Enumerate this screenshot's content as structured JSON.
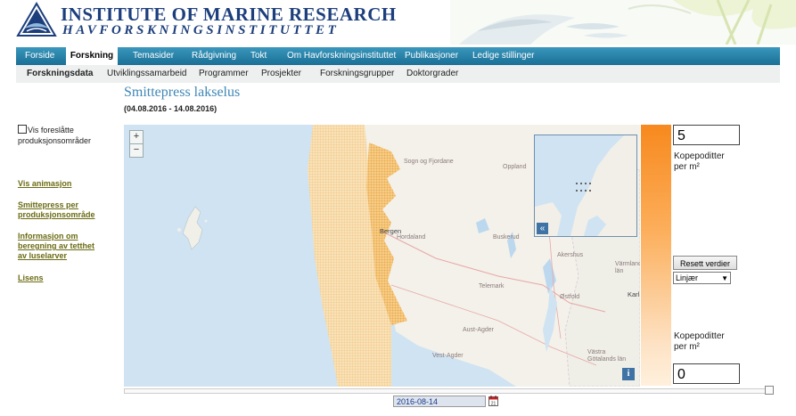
{
  "header": {
    "institute_name": "INSTITUTE OF MARINE RESEARCH",
    "institute_name_no": "HAVFORSKNINGSINSTITUTTET"
  },
  "nav_main": {
    "items": [
      {
        "label": "Forside"
      },
      {
        "label": "Forskning",
        "active": true
      },
      {
        "label": "Temasider"
      },
      {
        "label": "Rådgivning"
      },
      {
        "label": "Tokt"
      },
      {
        "label": "Om Havforskningsinstituttet"
      },
      {
        "label": "Publikasjoner"
      },
      {
        "label": "Ledige stillinger"
      }
    ]
  },
  "nav_sub": {
    "items": [
      {
        "label": "Forskningsdata",
        "active": true
      },
      {
        "label": "Utviklingssamarbeid"
      },
      {
        "label": "Programmer"
      },
      {
        "label": "Prosjekter"
      },
      {
        "label": "Forskningsgrupper"
      },
      {
        "label": "Doktorgrader"
      }
    ]
  },
  "page": {
    "title": "Smittepress lakselus",
    "date_range": "(04.08.2016 - 14.08.2016)"
  },
  "sidebar": {
    "checkbox_label": "Vis foreslåtte produksjonsområder",
    "checkbox_checked": false,
    "links": [
      {
        "label": "Vis animasjon"
      },
      {
        "label": "Smittepress per produksjonsområde"
      },
      {
        "label": "Informasjon om beregning av tetthet av luselarver"
      },
      {
        "label": "Lisens"
      }
    ]
  },
  "map": {
    "zoom_in": "+",
    "zoom_out": "−",
    "inset_toggle": "«",
    "info": "i",
    "labels": {
      "sogn": "Sogn og Fjordane",
      "oppland": "Oppland",
      "bergen": "Bergen",
      "hordaland": "Hordaland",
      "buskerud": "Buskerud",
      "akershus": "Akershus",
      "varmland": "Värmland län",
      "telemark": "Telemark",
      "ostfold": "Østfold",
      "karl": "Karl",
      "aust_agder": "Aust-Agder",
      "vest_agder": "Vest-Agder",
      "vastra": "Västra Götalands län"
    }
  },
  "legend": {
    "max_value": "5",
    "min_value": "0",
    "unit_top_line1": "Kopepoditter",
    "unit_top_line2": "per m²",
    "unit_bottom_line1": "Kopepoditter",
    "unit_bottom_line2": "per m²",
    "reset_label": "Resett verdier",
    "scale_selected": "Linjær",
    "colors": {
      "high": "#f7891e",
      "low": "#fff0dc"
    }
  },
  "timeline": {
    "date_value": "2016-08-14",
    "slider_position": 1.0
  }
}
